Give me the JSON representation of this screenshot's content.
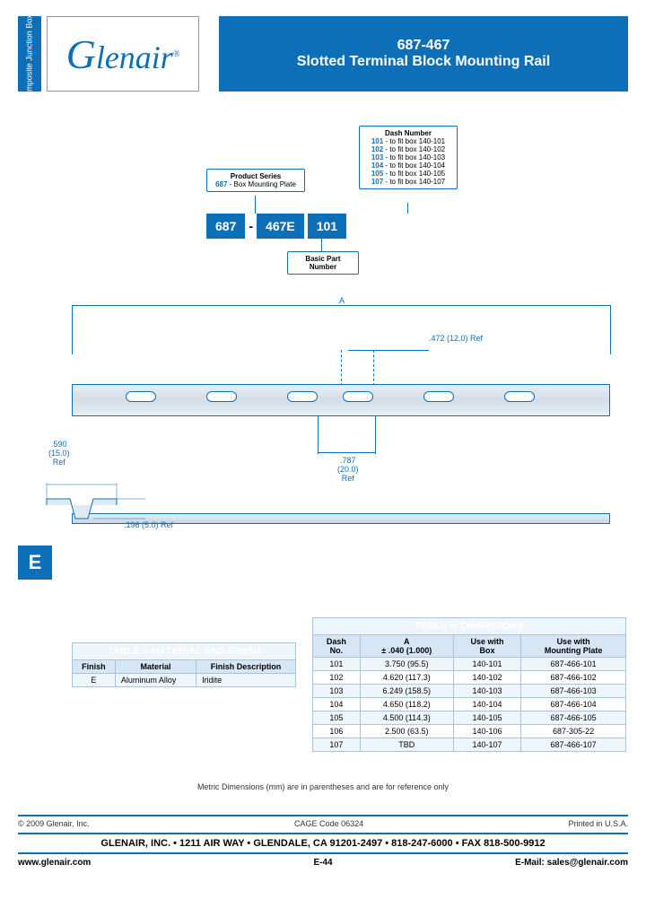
{
  "side_tab": "Composite\nJunction\nBoxes",
  "logo": "Glenair",
  "logo_reg": "®",
  "title": {
    "part_no": "687-467",
    "name": "Slotted Terminal Block Mounting Rail"
  },
  "pn_diagram": {
    "product_series": {
      "heading": "Product Series",
      "num": "687",
      "desc": " - Box Mounting Plate"
    },
    "dash_number": {
      "heading": "Dash Number",
      "rows": [
        {
          "num": "101",
          "desc": " - to fit box 140-101"
        },
        {
          "num": "102",
          "desc": " - to fit box 140-102"
        },
        {
          "num": "103",
          "desc": " - to fit box 140-103"
        },
        {
          "num": "104",
          "desc": " - to fit box 140-104"
        },
        {
          "num": "105",
          "desc": " - to fit box 140-105"
        },
        {
          "num": "107",
          "desc": " - to fit box 140-107"
        }
      ]
    },
    "basic": {
      "heading": "Basic Part\nNumber"
    },
    "boxes": {
      "a": "687",
      "b": "467E",
      "c": "101"
    }
  },
  "dims": {
    "a": "A",
    "d472": ".472 (12.0) Ref",
    "d787": ".787\n(20.0)\nRef",
    "d590": ".590\n(15.0)\nRef",
    "d196": ".196 (5.0) Ref"
  },
  "e_tab": "E",
  "table1": {
    "title": "TABLE I: MATERIAL AND FINISH",
    "headers": [
      "Finish",
      "Material",
      "Finish Description"
    ],
    "row": {
      "finish": "E",
      "material": "Aluminum Alloy",
      "desc": "Iridite"
    }
  },
  "table2": {
    "title": "TABLE II: DIMENSIONS",
    "headers": [
      "Dash\nNo.",
      "A\n± .040 (1.000)",
      "Use with\nBox",
      "Use with\nMounting Plate"
    ],
    "rows": [
      {
        "dash": "101",
        "a": "3.750   (95.5)",
        "box": "140-101",
        "mp": "687-466-101"
      },
      {
        "dash": "102",
        "a": "4.620 (117.3)",
        "box": "140-102",
        "mp": "687-466-102"
      },
      {
        "dash": "103",
        "a": "6.249 (158.5)",
        "box": "140-103",
        "mp": "687-466-103"
      },
      {
        "dash": "104",
        "a": "4.650 (118.2)",
        "box": "140-104",
        "mp": "687-466-104"
      },
      {
        "dash": "105",
        "a": "4.500 (114.3)",
        "box": "140-105",
        "mp": "687-466-105"
      },
      {
        "dash": "106",
        "a": "2.500   (63.5)",
        "box": "140-106",
        "mp": "687-305-22"
      },
      {
        "dash": "107",
        "a": "TBD",
        "box": "140-107",
        "mp": "687-466-107"
      }
    ]
  },
  "metric_note": "Metric Dimensions (mm) are in parentheses and are for reference only",
  "footer": {
    "copyright": "© 2009 Glenair, Inc.",
    "cage": "CAGE Code 06324",
    "printed": "Printed in U.S.A.",
    "addr": "GLENAIR, INC. • 1211 AIR WAY • GLENDALE, CA 91201-2497 • 818-247-6000 • FAX 818-500-9912",
    "www": "www.glenair.com",
    "page": "E-44",
    "email": "E-Mail: sales@glenair.com"
  }
}
